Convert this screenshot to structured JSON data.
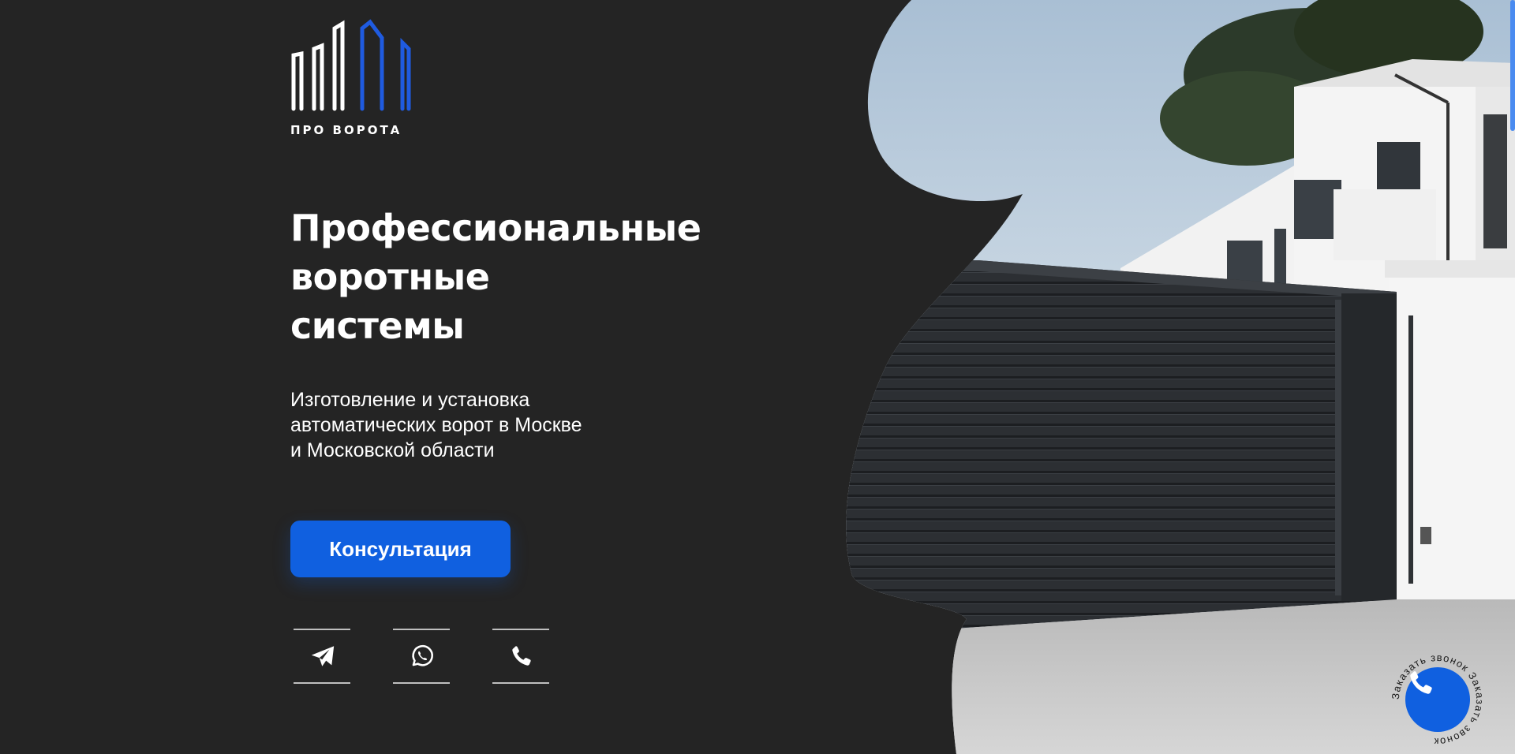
{
  "brand": {
    "name": "ПРО ВОРОТА",
    "accent_color": "#1060e0"
  },
  "hero": {
    "title_lines": [
      "Профессиональные",
      "воротные",
      "системы"
    ],
    "subtitle_lines": [
      "Изготовление и установка",
      "автоматических ворот в Москве",
      "и Московской области"
    ],
    "cta_label": "Консультация"
  },
  "social": [
    {
      "icon": "telegram-icon"
    },
    {
      "icon": "whatsapp-icon"
    },
    {
      "icon": "phone-icon"
    }
  ],
  "callback": {
    "label": "Заказать звонок Заказать звонок",
    "icon": "phone-icon"
  }
}
